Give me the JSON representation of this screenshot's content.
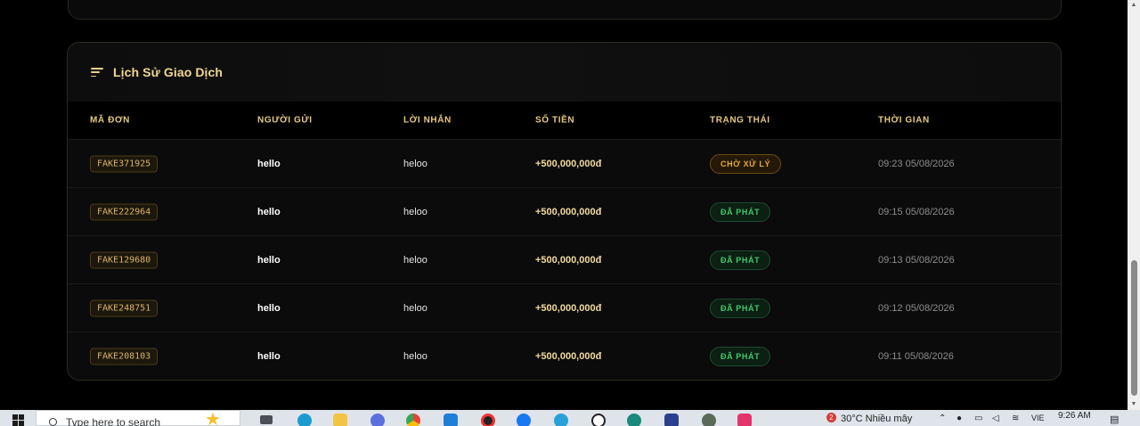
{
  "history": {
    "title": "Lịch Sử Giao Dịch",
    "columns": [
      "MÃ ĐƠN",
      "NGƯỜI GỬI",
      "LỜI NHẮN",
      "SỐ TIỀN",
      "TRẠNG THÁI",
      "THỜI GIAN"
    ],
    "rows": [
      {
        "code": "FAKE371925",
        "sender": "hello",
        "message": "heloo",
        "amount": "+500,000,000đ",
        "status": "CHỜ XỬ LÝ",
        "status_kind": "pending",
        "time": "09:23 05/08/2026"
      },
      {
        "code": "FAKE222964",
        "sender": "hello",
        "message": "heloo",
        "amount": "+500,000,000đ",
        "status": "ĐÃ PHÁT",
        "status_kind": "done",
        "time": "09:15 05/08/2026"
      },
      {
        "code": "FAKE129680",
        "sender": "hello",
        "message": "heloo",
        "amount": "+500,000,000đ",
        "status": "ĐÃ PHÁT",
        "status_kind": "done",
        "time": "09:13 05/08/2026"
      },
      {
        "code": "FAKE248751",
        "sender": "hello",
        "message": "heloo",
        "amount": "+500,000,000đ",
        "status": "ĐÃ PHÁT",
        "status_kind": "done",
        "time": "09:12 05/08/2026"
      },
      {
        "code": "FAKE208103",
        "sender": "hello",
        "message": "heloo",
        "amount": "+500,000,000đ",
        "status": "ĐÃ PHÁT",
        "status_kind": "done",
        "time": "09:11 05/08/2026"
      }
    ]
  },
  "colors": {
    "accent_gold": "#f1d795",
    "pending": "#e6a93a",
    "done": "#3fca6c",
    "background": "#000000"
  },
  "taskbar": {
    "search_placeholder": "Type here to search",
    "weather": "30°C  Nhiều mây",
    "notification_count": "2",
    "language": "VIE",
    "time": "9:26 AM"
  }
}
